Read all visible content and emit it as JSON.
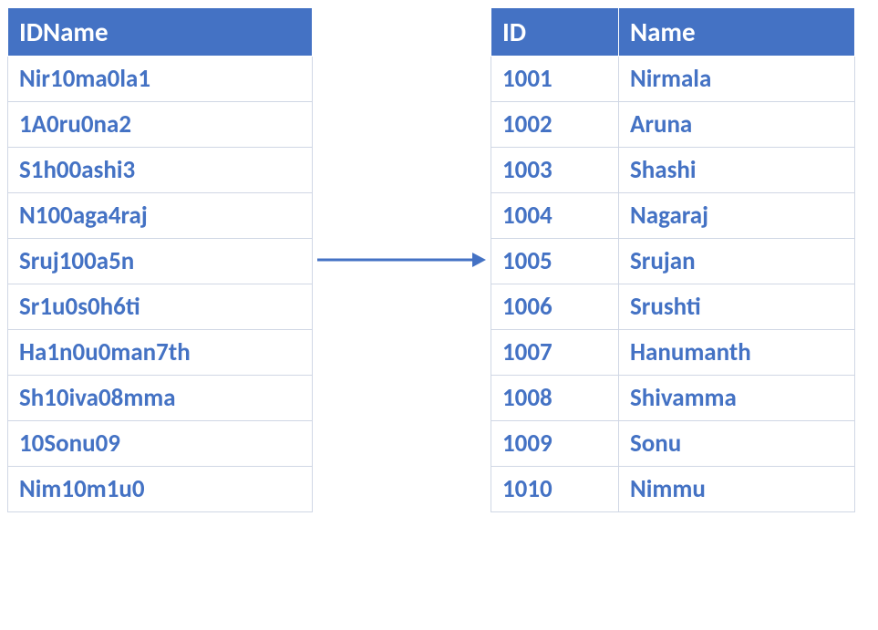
{
  "left_table": {
    "header": "IDName",
    "rows": [
      "Nir10ma0la1",
      "1A0ru0na2",
      "S1h00ashi3",
      "N100aga4raj",
      "Sruj100a5n",
      "Sr1u0s0h6ti",
      "Ha1n0u0man7th",
      "Sh10iva08mma",
      "10Sonu09",
      "Nim10m1u0"
    ]
  },
  "right_table": {
    "headers": [
      "ID",
      "Name"
    ],
    "rows": [
      {
        "id": "1001",
        "name": "Nirmala"
      },
      {
        "id": "1002",
        "name": "Aruna"
      },
      {
        "id": "1003",
        "name": "Shashi"
      },
      {
        "id": "1004",
        "name": "Nagaraj"
      },
      {
        "id": "1005",
        "name": "Srujan"
      },
      {
        "id": "1006",
        "name": "Srushti"
      },
      {
        "id": "1007",
        "name": "Hanumanth"
      },
      {
        "id": "1008",
        "name": "Shivamma"
      },
      {
        "id": "1009",
        "name": "Sonu"
      },
      {
        "id": "1010",
        "name": "Nimmu"
      }
    ]
  },
  "colors": {
    "header_bg": "#4472C4",
    "text": "#4472C4",
    "arrow": "#4472C4"
  }
}
